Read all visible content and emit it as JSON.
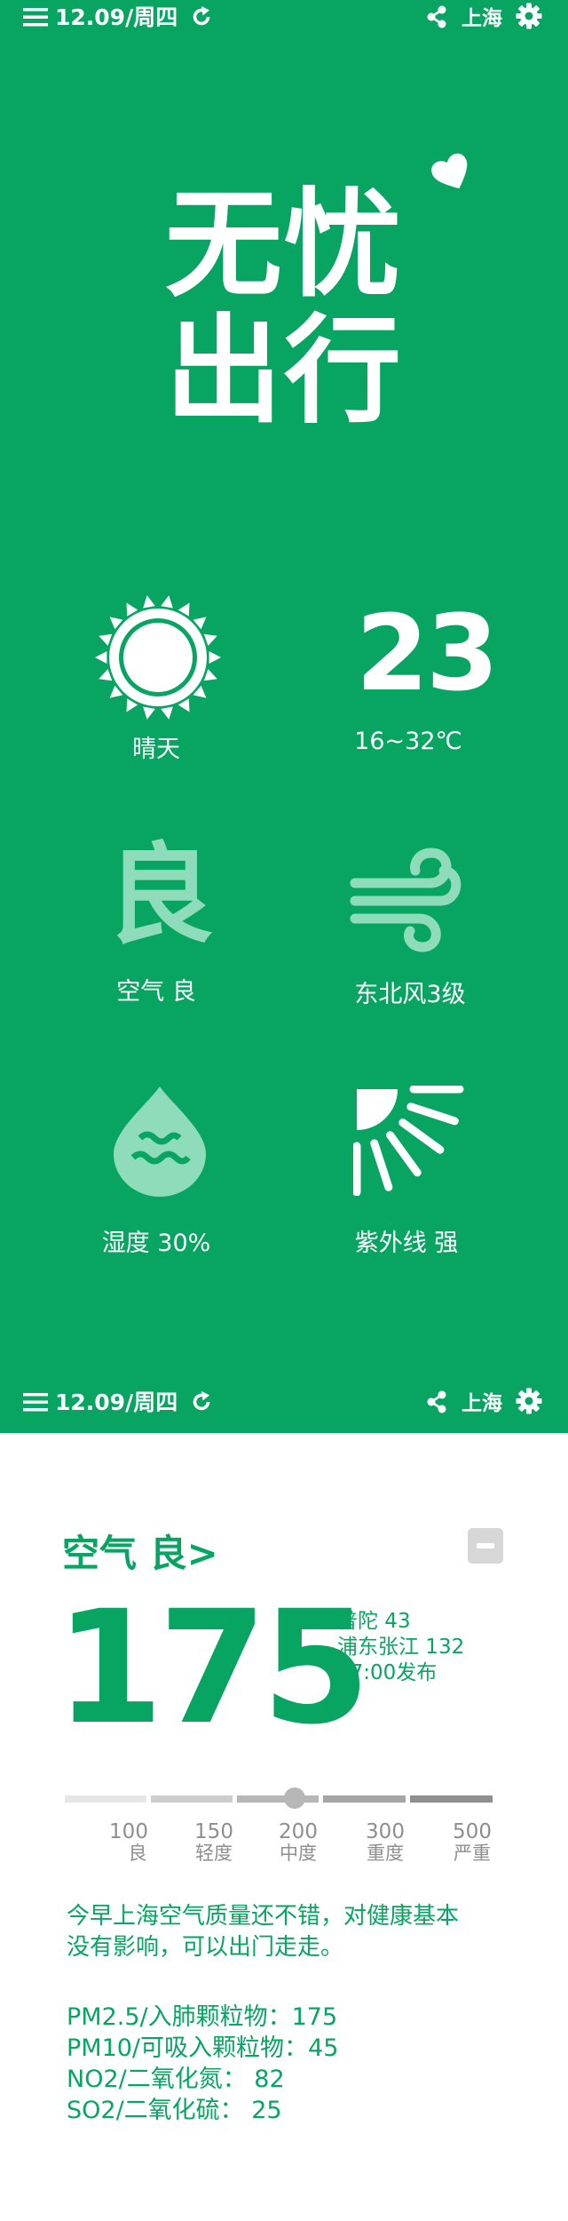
{
  "topbar": {
    "date": "12.09/周四",
    "city": "上海"
  },
  "hero": {
    "line1": "无忧",
    "line2": "出行"
  },
  "weather": {
    "condition": "晴天",
    "temperature": "23",
    "temp_range": "16~32℃",
    "air_grade_glyph": "良",
    "air_label": "空气 良",
    "wind": "东北风3级",
    "humidity": "湿度 30%",
    "uv": "紫外线  强"
  },
  "air": {
    "title": "空气 良>",
    "aqi": "175",
    "stations": [
      "普陀 43",
      "浦东张江 132"
    ],
    "published": "17:00发布",
    "scale": [
      {
        "value": "100",
        "label": "良"
      },
      {
        "value": "150",
        "label": "轻度"
      },
      {
        "value": "200",
        "label": "中度"
      },
      {
        "value": "300",
        "label": "重度"
      },
      {
        "value": "500",
        "label": "严重"
      }
    ],
    "description_lines": [
      "今早上海空气质量还不错，对健康基本",
      "没有影响，可以出门走走。"
    ],
    "pollutants": [
      "PM2.5/入肺颗粒物：175",
      "PM10/可吸入颗粒物：45",
      "NO2/二氧化氮：  82",
      "SO2/二氧化硫：  25"
    ]
  },
  "colors": {
    "brand_green": "#08a562",
    "light_green": "#8fdcbb",
    "scale_gray": "#b7b7b7"
  }
}
